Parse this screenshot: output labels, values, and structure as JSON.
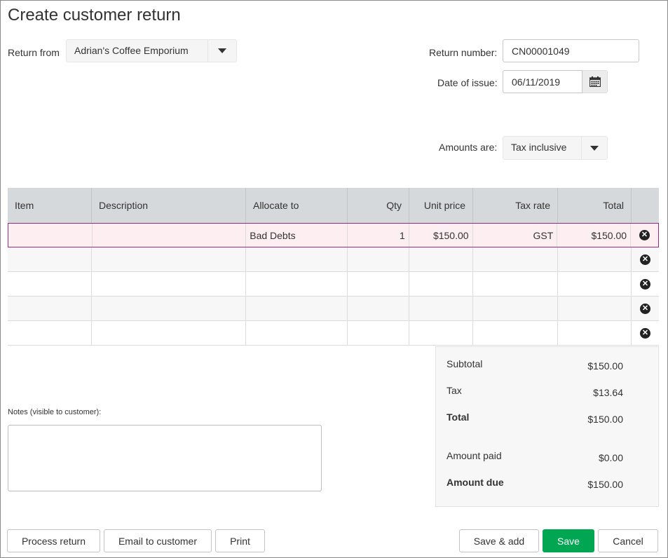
{
  "page": {
    "title": "Create customer return"
  },
  "form": {
    "return_from_label": "Return from",
    "return_from_value": "Adrian's Coffee Emporium",
    "return_number_label": "Return number:",
    "return_number_value": "CN00001049",
    "date_label": "Date of issue:",
    "date_value": "06/11/2019",
    "amounts_label": "Amounts are:",
    "amounts_value": "Tax inclusive"
  },
  "table": {
    "headers": [
      "Item",
      "Description",
      "Allocate to",
      "Qty",
      "Unit price",
      "Tax rate",
      "Total"
    ],
    "rows": [
      {
        "item": "",
        "description": "",
        "allocate_to": "Bad Debts",
        "qty": "1",
        "unit_price": "$150.00",
        "tax_rate": "GST",
        "total": "$150.00"
      }
    ]
  },
  "notes": {
    "label": "Notes (visible to customer):",
    "value": ""
  },
  "totals": {
    "subtotal_label": "Subtotal",
    "subtotal": "$150.00",
    "tax_label": "Tax",
    "tax": "$13.64",
    "total_label": "Total",
    "total": "$150.00",
    "paid_label": "Amount paid",
    "paid": "$0.00",
    "due_label": "Amount due",
    "due": "$150.00"
  },
  "buttons": {
    "process_return": "Process return",
    "email": "Email to customer",
    "print": "Print",
    "save_add": "Save & add",
    "save": "Save",
    "cancel": "Cancel"
  },
  "colors": {
    "primary": "#00a651",
    "selected_row_border": "#9b2a7c",
    "selected_row_bg": "#fdeef1",
    "header_bg": "#d5d9db"
  },
  "icons": {
    "dropdown": "chevron-down-icon",
    "calendar": "calendar-icon",
    "remove_row": "remove-circle-icon"
  }
}
